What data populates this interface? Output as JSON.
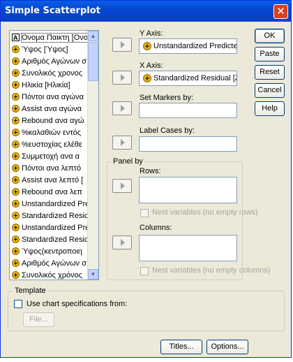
{
  "window": {
    "title": "Simple Scatterplot",
    "close_glyph": "✕"
  },
  "variables": [
    {
      "label": "Ονομα Παικτη [Ονομ",
      "icon": "string-variable-icon"
    },
    {
      "label": "Ύψος [Ύψος]",
      "icon": "scale-variable-icon"
    },
    {
      "label": "Αριθμός Αγώνων σ",
      "icon": "scale-variable-icon"
    },
    {
      "label": "Συνολικός χρονος",
      "icon": "scale-variable-icon"
    },
    {
      "label": "Ηλικία [Ηλικία]",
      "icon": "scale-variable-icon"
    },
    {
      "label": "Πόντοι ανα αγώνα",
      "icon": "scale-variable-icon"
    },
    {
      "label": "Assist ανα αγώνα",
      "icon": "scale-variable-icon"
    },
    {
      "label": "Rebound ανα αγώ",
      "icon": "scale-variable-icon"
    },
    {
      "label": "%καλαθιών εντός",
      "icon": "scale-variable-icon"
    },
    {
      "label": "%ευστοχίας ελέθε",
      "icon": "scale-variable-icon"
    },
    {
      "label": "Συμμετοχή ανα α",
      "icon": "scale-variable-icon"
    },
    {
      "label": "Πόντοι ανα λεπτό",
      "icon": "scale-variable-icon"
    },
    {
      "label": "Assist ανα λεπτό [",
      "icon": "scale-variable-icon"
    },
    {
      "label": "Rebound ανα λεπ",
      "icon": "scale-variable-icon"
    },
    {
      "label": "Unstandardized Pre",
      "icon": "scale-variable-icon"
    },
    {
      "label": "Standardized Resic",
      "icon": "scale-variable-icon"
    },
    {
      "label": "Unstandardized Pre",
      "icon": "scale-variable-icon"
    },
    {
      "label": "Standardized Resic",
      "icon": "scale-variable-icon"
    },
    {
      "label": "Ύψος(κεντροποιη",
      "icon": "scale-variable-icon"
    },
    {
      "label": "Αριθμός Αγώνων σ",
      "icon": "scale-variable-icon"
    },
    {
      "label": "Συνολικός χρόνος",
      "icon": "scale-variable-icon"
    }
  ],
  "y_axis": {
    "label": "Y Axis:",
    "value": "Unstandardized Predicte"
  },
  "x_axis": {
    "label": "X Axis:",
    "value": "Standardized Residual [Z"
  },
  "markers": {
    "label": "Set Markers by:",
    "value": ""
  },
  "cases": {
    "label": "Label Cases by:",
    "value": ""
  },
  "panel": {
    "title": "Panel by",
    "rows_label": "Rows:",
    "columns_label": "Columns:",
    "nest_rows": "Nest variables (no empty rows)",
    "nest_cols": "Nest variables (no empty columns)"
  },
  "template": {
    "title": "Template",
    "use_label": "Use chart specifications from:",
    "file_button": "File..."
  },
  "buttons": {
    "ok": "OK",
    "paste": "Paste",
    "reset": "Reset",
    "cancel": "Cancel",
    "help": "Help",
    "titles": "Titles...",
    "options": "Options..."
  },
  "colors": {
    "titlebar": "#0a5ee8",
    "dialog": "#ece9d8",
    "field_border": "#7f9db9"
  }
}
